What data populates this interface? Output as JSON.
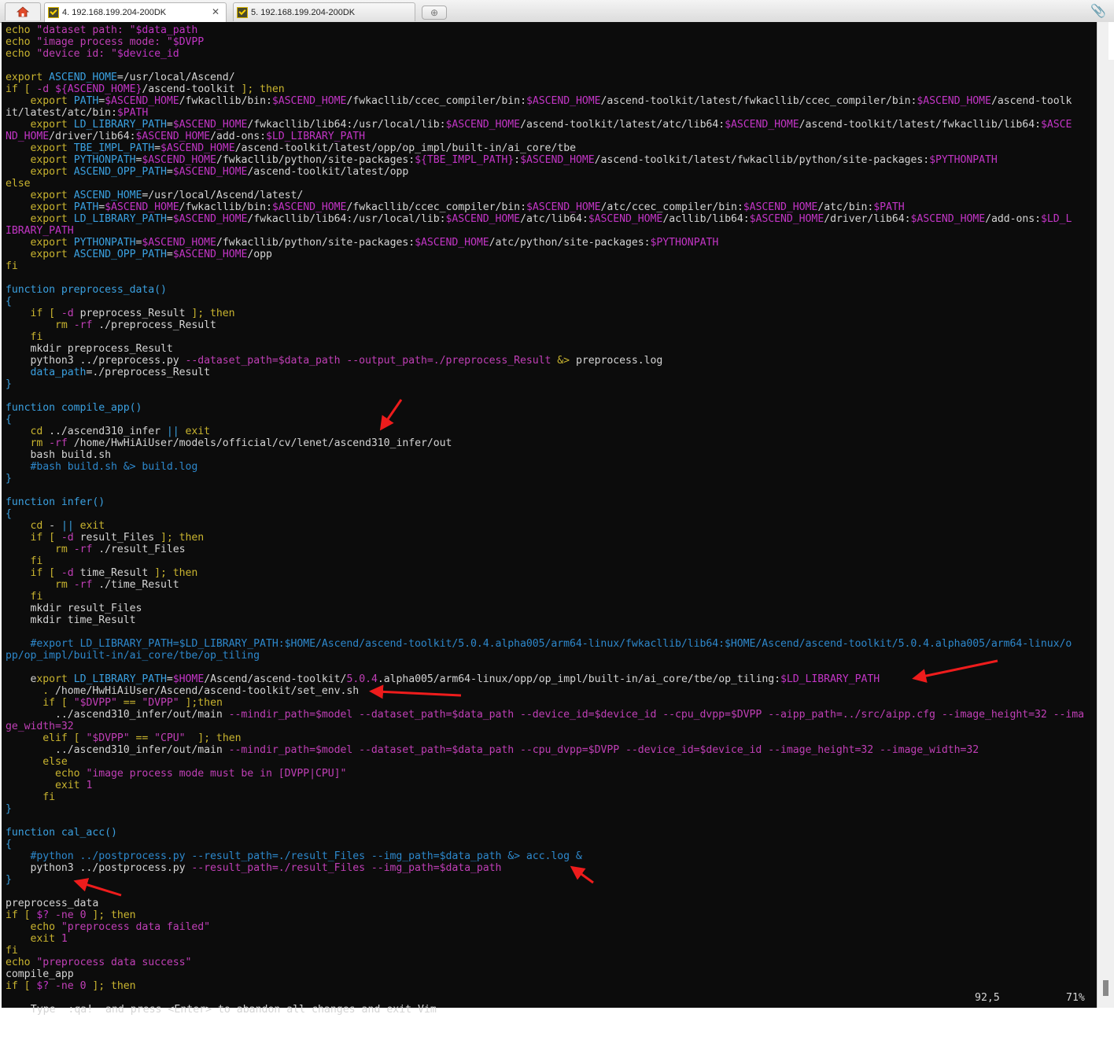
{
  "tabs": [
    {
      "label": "4. 192.168.199.204-200DK",
      "active": true
    },
    {
      "label": "5. 192.168.199.204-200DK",
      "active": false
    }
  ],
  "colors": {
    "terminal_bg": "#0c0c0c",
    "keyword": "#c9b42f",
    "string": "#c03fb6",
    "blue": "#3aa0e0",
    "arrow": "#ee1c1c"
  },
  "status": {
    "message": "Type  :qa!  and press <Enter> to abandon all changes and exit Vim",
    "position": "92,5",
    "percent": "71%"
  },
  "lines": [
    [
      [
        "kw",
        "echo "
      ],
      [
        "str",
        "\"dataset path: \""
      ],
      [
        "var",
        "$data_path"
      ]
    ],
    [
      [
        "kw",
        "echo "
      ],
      [
        "str",
        "\"image process mode: \""
      ],
      [
        "var",
        "$DVPP"
      ]
    ],
    [
      [
        "kw",
        "echo "
      ],
      [
        "str",
        "\"device id: \""
      ],
      [
        "var",
        "$device_id"
      ]
    ],
    [],
    [
      [
        "kw",
        "export "
      ],
      [
        "blue",
        "ASCEND_HOME"
      ],
      [
        "text",
        "=/usr/local/Ascend/"
      ]
    ],
    [
      [
        "kw",
        "if [ "
      ],
      [
        "opt",
        "-d "
      ],
      [
        "var",
        "${ASCEND_HOME}"
      ],
      [
        "text",
        "/ascend-toolkit "
      ],
      [
        "kw",
        "]; then"
      ]
    ],
    [
      [
        "kw",
        "    export "
      ],
      [
        "blue",
        "PATH"
      ],
      [
        "text",
        "="
      ],
      [
        "var",
        "$ASCEND_HOME"
      ],
      [
        "text",
        "/fwkacllib/bin:"
      ],
      [
        "var",
        "$ASCEND_HOME"
      ],
      [
        "text",
        "/fwkacllib/ccec_compiler/bin:"
      ],
      [
        "var",
        "$ASCEND_HOME"
      ],
      [
        "text",
        "/ascend-toolkit/latest/fwkacllib/ccec_compiler/bin:"
      ],
      [
        "var",
        "$ASCEND_HOME"
      ],
      [
        "text",
        "/ascend-toolk"
      ]
    ],
    [
      [
        "text",
        "it/latest/atc/bin:"
      ],
      [
        "var",
        "$PATH"
      ]
    ],
    [
      [
        "kw",
        "    export "
      ],
      [
        "blue",
        "LD_LIBRARY_PATH"
      ],
      [
        "text",
        "="
      ],
      [
        "var",
        "$ASCEND_HOME"
      ],
      [
        "text",
        "/fwkacllib/lib64:/usr/local/lib:"
      ],
      [
        "var",
        "$ASCEND_HOME"
      ],
      [
        "text",
        "/ascend-toolkit/latest/atc/lib64:"
      ],
      [
        "var",
        "$ASCEND_HOME"
      ],
      [
        "text",
        "/ascend-toolkit/latest/fwkacllib/lib64:"
      ],
      [
        "var",
        "$ASCE"
      ]
    ],
    [
      [
        "var",
        "ND_HOME"
      ],
      [
        "text",
        "/driver/lib64:"
      ],
      [
        "var",
        "$ASCEND_HOME"
      ],
      [
        "text",
        "/add-ons:"
      ],
      [
        "var",
        "$LD_LIBRARY_PATH"
      ]
    ],
    [
      [
        "kw",
        "    export "
      ],
      [
        "blue",
        "TBE_IMPL_PATH"
      ],
      [
        "text",
        "="
      ],
      [
        "var",
        "$ASCEND_HOME"
      ],
      [
        "text",
        "/ascend-toolkit/latest/opp/op_impl/built-in/ai_core/tbe"
      ]
    ],
    [
      [
        "kw",
        "    export "
      ],
      [
        "blue",
        "PYTHONPATH"
      ],
      [
        "text",
        "="
      ],
      [
        "var",
        "$ASCEND_HOME"
      ],
      [
        "text",
        "/fwkacllib/python/site-packages:"
      ],
      [
        "var",
        "${TBE_IMPL_PATH}"
      ],
      [
        "text",
        ":"
      ],
      [
        "var",
        "$ASCEND_HOME"
      ],
      [
        "text",
        "/ascend-toolkit/latest/fwkacllib/python/site-packages:"
      ],
      [
        "var",
        "$PYTHONPATH"
      ]
    ],
    [
      [
        "kw",
        "    export "
      ],
      [
        "blue",
        "ASCEND_OPP_PATH"
      ],
      [
        "text",
        "="
      ],
      [
        "var",
        "$ASCEND_HOME"
      ],
      [
        "text",
        "/ascend-toolkit/latest/opp"
      ]
    ],
    [
      [
        "kw",
        "else"
      ]
    ],
    [
      [
        "kw",
        "    export "
      ],
      [
        "blue",
        "ASCEND_HOME"
      ],
      [
        "text",
        "=/usr/local/Ascend/latest/"
      ]
    ],
    [
      [
        "kw",
        "    export "
      ],
      [
        "blue",
        "PATH"
      ],
      [
        "text",
        "="
      ],
      [
        "var",
        "$ASCEND_HOME"
      ],
      [
        "text",
        "/fwkacllib/bin:"
      ],
      [
        "var",
        "$ASCEND_HOME"
      ],
      [
        "text",
        "/fwkacllib/ccec_compiler/bin:"
      ],
      [
        "var",
        "$ASCEND_HOME"
      ],
      [
        "text",
        "/atc/ccec_compiler/bin:"
      ],
      [
        "var",
        "$ASCEND_HOME"
      ],
      [
        "text",
        "/atc/bin:"
      ],
      [
        "var",
        "$PATH"
      ]
    ],
    [
      [
        "kw",
        "    export "
      ],
      [
        "blue",
        "LD_LIBRARY_PATH"
      ],
      [
        "text",
        "="
      ],
      [
        "var",
        "$ASCEND_HOME"
      ],
      [
        "text",
        "/fwkacllib/lib64:/usr/local/lib:"
      ],
      [
        "var",
        "$ASCEND_HOME"
      ],
      [
        "text",
        "/atc/lib64:"
      ],
      [
        "var",
        "$ASCEND_HOME"
      ],
      [
        "text",
        "/acllib/lib64:"
      ],
      [
        "var",
        "$ASCEND_HOME"
      ],
      [
        "text",
        "/driver/lib64:"
      ],
      [
        "var",
        "$ASCEND_HOME"
      ],
      [
        "text",
        "/add-ons:"
      ],
      [
        "var",
        "$LD_L"
      ]
    ],
    [
      [
        "var",
        "IBRARY_PATH"
      ]
    ],
    [
      [
        "kw",
        "    export "
      ],
      [
        "blue",
        "PYTHONPATH"
      ],
      [
        "text",
        "="
      ],
      [
        "var",
        "$ASCEND_HOME"
      ],
      [
        "text",
        "/fwkacllib/python/site-packages:"
      ],
      [
        "var",
        "$ASCEND_HOME"
      ],
      [
        "text",
        "/atc/python/site-packages:"
      ],
      [
        "var",
        "$PYTHONPATH"
      ]
    ],
    [
      [
        "kw",
        "    export "
      ],
      [
        "blue",
        "ASCEND_OPP_PATH"
      ],
      [
        "text",
        "="
      ],
      [
        "var",
        "$ASCEND_HOME"
      ],
      [
        "text",
        "/opp"
      ]
    ],
    [
      [
        "kw",
        "fi"
      ]
    ],
    [],
    [
      [
        "blue",
        "function preprocess_data()"
      ]
    ],
    [
      [
        "blue",
        "{"
      ]
    ],
    [
      [
        "kw",
        "    if [ "
      ],
      [
        "opt",
        "-d "
      ],
      [
        "text",
        "preprocess_Result "
      ],
      [
        "kw",
        "]; then"
      ]
    ],
    [
      [
        "text",
        "        "
      ],
      [
        "kw",
        "rm "
      ],
      [
        "opt",
        "-rf "
      ],
      [
        "text",
        "./preprocess_Result"
      ]
    ],
    [
      [
        "kw",
        "    fi"
      ]
    ],
    [
      [
        "text",
        "    mkdir preprocess_Result"
      ]
    ],
    [
      [
        "text",
        "    python3 ../preprocess.py "
      ],
      [
        "opt",
        "--dataset_path=$data_path --output_path=./preprocess_Result "
      ],
      [
        "kw",
        "&> "
      ],
      [
        "text",
        "preprocess.log"
      ]
    ],
    [
      [
        "blue",
        "    data_path"
      ],
      [
        "text",
        "=./preprocess_Result"
      ]
    ],
    [
      [
        "blue",
        "}"
      ]
    ],
    [],
    [
      [
        "blue",
        "function compile_app()"
      ]
    ],
    [
      [
        "blue",
        "{"
      ]
    ],
    [
      [
        "kw",
        "    cd "
      ],
      [
        "text",
        "../ascend310_infer "
      ],
      [
        "blue",
        "|| "
      ],
      [
        "kw",
        "exit"
      ]
    ],
    [
      [
        "kw",
        "    rm "
      ],
      [
        "opt",
        "-rf "
      ],
      [
        "text",
        "/home/HwHiAiUser/models/official/cv/lenet/ascend310_infer/out"
      ]
    ],
    [
      [
        "text",
        "    bash build.sh"
      ]
    ],
    [
      [
        "cmt",
        "    #bash build.sh &> build.log"
      ]
    ],
    [
      [
        "blue",
        "}"
      ]
    ],
    [],
    [
      [
        "blue",
        "function infer()"
      ]
    ],
    [
      [
        "blue",
        "{"
      ]
    ],
    [
      [
        "kw",
        "    cd "
      ],
      [
        "text",
        "- "
      ],
      [
        "blue",
        "|| "
      ],
      [
        "kw",
        "exit"
      ]
    ],
    [
      [
        "kw",
        "    if [ "
      ],
      [
        "opt",
        "-d "
      ],
      [
        "text",
        "result_Files "
      ],
      [
        "kw",
        "]; then"
      ]
    ],
    [
      [
        "text",
        "        "
      ],
      [
        "kw",
        "rm "
      ],
      [
        "opt",
        "-rf "
      ],
      [
        "text",
        "./result_Files"
      ]
    ],
    [
      [
        "kw",
        "    fi"
      ]
    ],
    [
      [
        "kw",
        "    if [ "
      ],
      [
        "opt",
        "-d "
      ],
      [
        "text",
        "time_Result "
      ],
      [
        "kw",
        "]; then"
      ]
    ],
    [
      [
        "text",
        "        "
      ],
      [
        "kw",
        "rm "
      ],
      [
        "opt",
        "-rf "
      ],
      [
        "text",
        "./time_Result"
      ]
    ],
    [
      [
        "kw",
        "    fi"
      ]
    ],
    [
      [
        "text",
        "    mkdir result_Files"
      ]
    ],
    [
      [
        "text",
        "    mkdir time_Result"
      ]
    ],
    [],
    [
      [
        "cmt",
        "    #export LD_LIBRARY_PATH=$LD_LIBRARY_PATH:$HOME/Ascend/ascend-toolkit/5.0.4.alpha005/arm64-linux/fwkacllib/lib64:$HOME/Ascend/ascend-toolkit/5.0.4.alpha005/arm64-linux/o"
      ]
    ],
    [
      [
        "cmt",
        "pp/op_impl/built-in/ai_core/tbe/op_tiling"
      ]
    ],
    [],
    [
      [
        "text",
        "    "
      ],
      [
        "cursor",
        "e"
      ],
      [
        "kw",
        "xport "
      ],
      [
        "blue",
        "LD_LIBRARY_PATH"
      ],
      [
        "text",
        "="
      ],
      [
        "var",
        "$HOME"
      ],
      [
        "text",
        "/Ascend/ascend-toolkit/"
      ],
      [
        "num",
        "5.0.4"
      ],
      [
        "text",
        ".alpha005/arm64-linux/opp/op_impl/built-in/ai_core/tbe/op_tiling:"
      ],
      [
        "var",
        "$LD_LIBRARY_PATH"
      ]
    ],
    [
      [
        "kw",
        "      . "
      ],
      [
        "text",
        "/home/HwHiAiUser/Ascend/ascend-toolkit/set_env.sh"
      ]
    ],
    [
      [
        "kw",
        "      if [ "
      ],
      [
        "str",
        "\"$DVPP\" "
      ],
      [
        "kw",
        "== "
      ],
      [
        "str",
        "\"DVPP\" "
      ],
      [
        "kw",
        "];then"
      ]
    ],
    [
      [
        "text",
        "        ../ascend310_infer/out/main "
      ],
      [
        "opt",
        "--mindir_path=$model --dataset_path=$data_path --device_id=$device_id --cpu_dvpp=$DVPP --aipp_path=../src/aipp.cfg --image_height=32 --ima"
      ]
    ],
    [
      [
        "opt",
        "ge_width=32"
      ]
    ],
    [
      [
        "kw",
        "      elif [ "
      ],
      [
        "str",
        "\"$DVPP\" "
      ],
      [
        "kw",
        "== "
      ],
      [
        "str",
        "\"CPU\"  "
      ],
      [
        "kw",
        "]; then"
      ]
    ],
    [
      [
        "text",
        "        ../ascend310_infer/out/main "
      ],
      [
        "opt",
        "--mindir_path=$model --dataset_path=$data_path --cpu_dvpp=$DVPP --device_id=$device_id --image_height=32 --image_width=32"
      ]
    ],
    [
      [
        "kw",
        "      else"
      ]
    ],
    [
      [
        "kw",
        "        echo "
      ],
      [
        "str",
        "\"image process mode must be in [DVPP|CPU]\""
      ]
    ],
    [
      [
        "kw",
        "        exit "
      ],
      [
        "num",
        "1"
      ]
    ],
    [
      [
        "kw",
        "      fi"
      ]
    ],
    [
      [
        "blue",
        "}"
      ]
    ],
    [],
    [
      [
        "blue",
        "function cal_acc()"
      ]
    ],
    [
      [
        "blue",
        "{"
      ]
    ],
    [
      [
        "cmt",
        "    #python ../postprocess.py --result_path=./result_Files --img_path=$data_path &> acc.log &"
      ]
    ],
    [
      [
        "text",
        "    python3 ../postprocess.py "
      ],
      [
        "opt",
        "--result_path=./result_Files --img_path=$data_path"
      ]
    ],
    [
      [
        "blue",
        "}"
      ]
    ],
    [],
    [
      [
        "text",
        "preprocess_data"
      ]
    ],
    [
      [
        "kw",
        "if [ "
      ],
      [
        "var",
        "$? "
      ],
      [
        "opt",
        "-ne "
      ],
      [
        "num",
        "0 "
      ],
      [
        "kw",
        "]; then"
      ]
    ],
    [
      [
        "kw",
        "    echo "
      ],
      [
        "str",
        "\"preprocess data failed\""
      ]
    ],
    [
      [
        "kw",
        "    exit "
      ],
      [
        "num",
        "1"
      ]
    ],
    [
      [
        "kw",
        "fi"
      ]
    ],
    [
      [
        "kw",
        "echo "
      ],
      [
        "str",
        "\"preprocess data success\""
      ]
    ],
    [
      [
        "text",
        "compile_app"
      ]
    ],
    [
      [
        "kw",
        "if [ "
      ],
      [
        "var",
        "$? "
      ],
      [
        "opt",
        "-ne "
      ],
      [
        "num",
        "0 "
      ],
      [
        "kw",
        "]; then"
      ]
    ]
  ]
}
